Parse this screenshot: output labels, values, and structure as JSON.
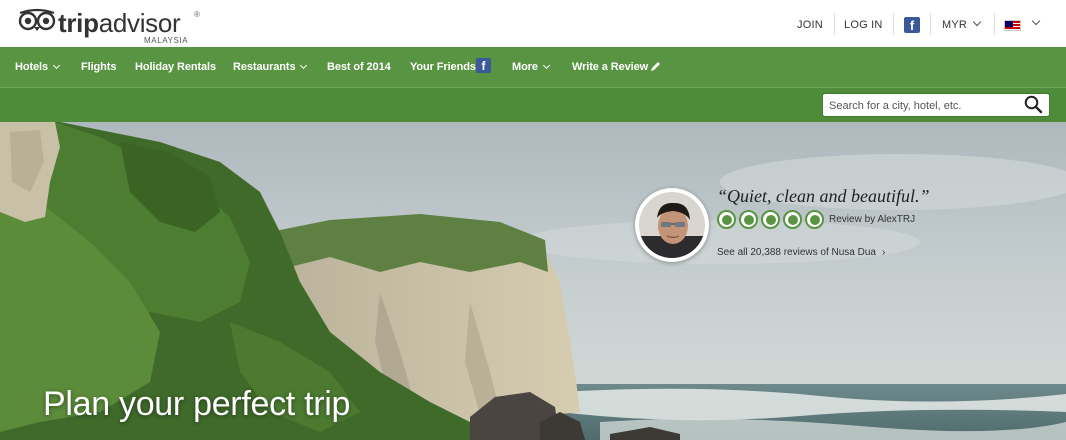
{
  "header": {
    "logo": {
      "brand_prefix": "trip",
      "brand_suffix": "advisor",
      "registered": "®",
      "country": "MALAYSIA",
      "icon": "owl-logo-icon"
    },
    "links": {
      "join": "JOIN",
      "login": "LOG IN",
      "facebook_icon": "facebook-icon",
      "currency": "MYR",
      "flag_icon": "malaysia-flag-icon"
    }
  },
  "nav": {
    "items": [
      {
        "label": "Hotels",
        "dropdown": true
      },
      {
        "label": "Flights",
        "dropdown": false
      },
      {
        "label": "Holiday Rentals",
        "dropdown": false
      },
      {
        "label": "Restaurants",
        "dropdown": true
      },
      {
        "label": "Best of 2014",
        "dropdown": false
      },
      {
        "label": "Your Friends",
        "dropdown": false,
        "icon": "facebook-icon"
      },
      {
        "label": "More",
        "dropdown": true
      },
      {
        "label": "Write a Review",
        "dropdown": false,
        "icon": "pencil-icon"
      }
    ]
  },
  "search": {
    "placeholder": "Search for a city, hotel, etc.",
    "icon": "search-icon"
  },
  "hero": {
    "headline": "Plan your perfect trip",
    "review": {
      "quote": "“Quiet, clean and beautiful.”",
      "rating": 5,
      "rating_max": 5,
      "reviewer_text": "Review by AlexTRJ",
      "see_all": "See all 20,388 reviews of Nusa Dua",
      "see_all_arrow": "›"
    }
  },
  "colors": {
    "brand_green": "#589442",
    "search_bar_green": "#4f8c39",
    "facebook_blue": "#3b5998"
  }
}
